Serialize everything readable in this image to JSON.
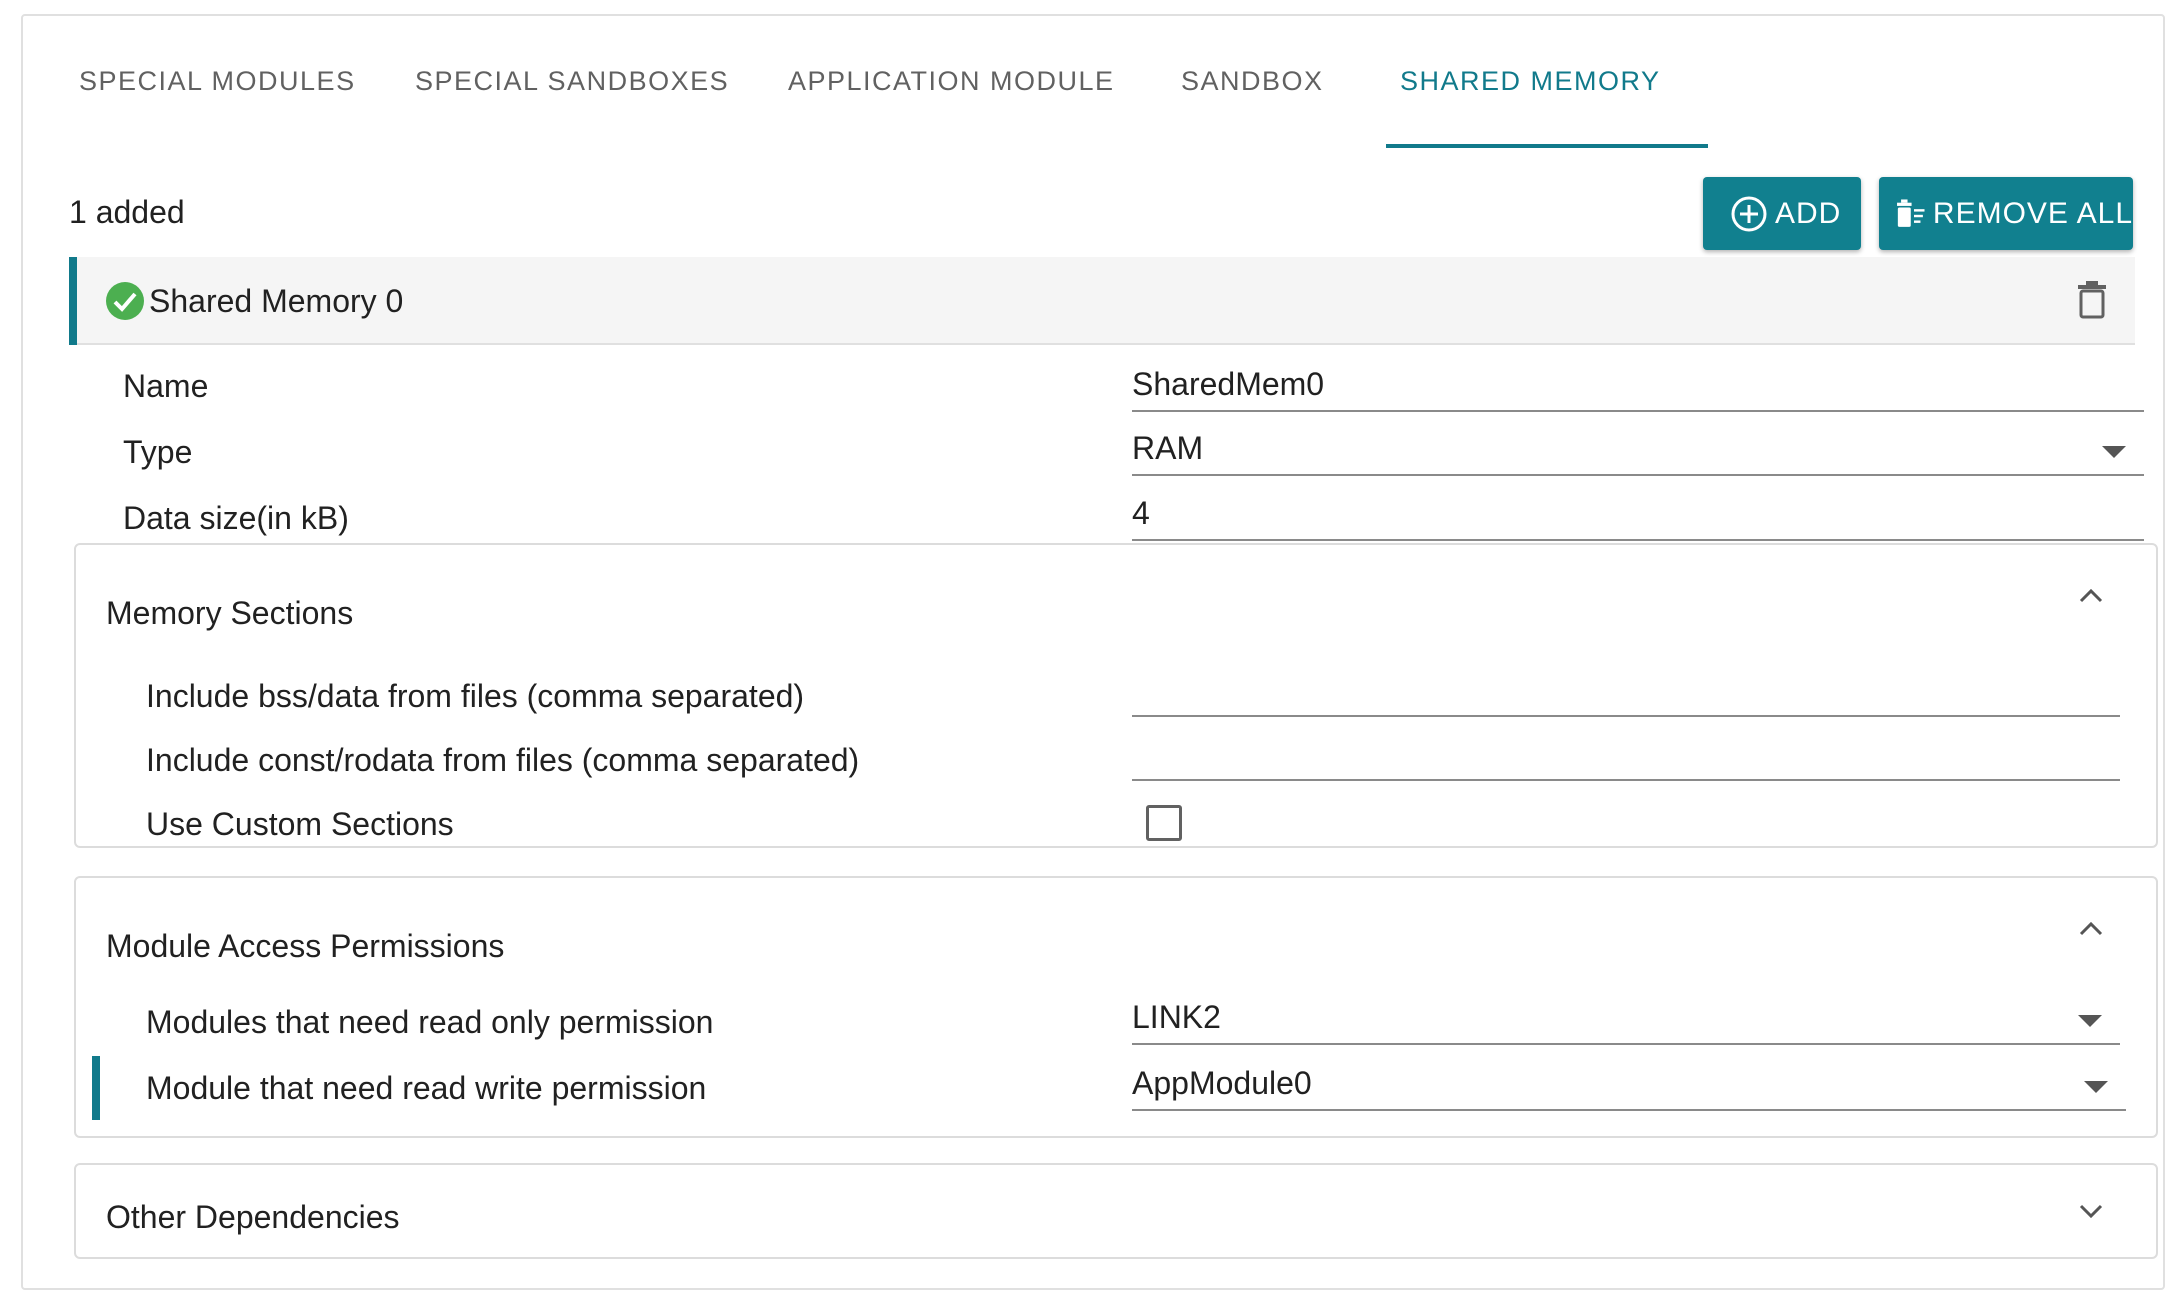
{
  "tabs": [
    {
      "label": "SPECIAL MODULES"
    },
    {
      "label": "SPECIAL SANDBOXES"
    },
    {
      "label": "APPLICATION MODULE"
    },
    {
      "label": "SANDBOX"
    },
    {
      "label": "SHARED MEMORY",
      "active": true
    }
  ],
  "toolbar": {
    "count_text": "1 added",
    "add_label": "ADD",
    "remove_all_label": "REMOVE ALL"
  },
  "item": {
    "title": "Shared Memory 0",
    "status_icon": "check-circle-icon",
    "fields": {
      "name": {
        "label": "Name",
        "value": "SharedMem0"
      },
      "type": {
        "label": "Type",
        "value": "RAM"
      },
      "data_size": {
        "label": "Data size(in kB)",
        "value": "4"
      }
    }
  },
  "memory_sections": {
    "title": "Memory Sections",
    "bss_label": "Include bss/data from files (comma separated)",
    "bss_value": "",
    "const_label": "Include const/rodata from files (comma separated)",
    "const_value": "",
    "custom_label": "Use Custom Sections",
    "custom_checked": false
  },
  "module_access": {
    "title": "Module Access Permissions",
    "read_only_label": "Modules that need read only permission",
    "read_only_value": "LINK2",
    "read_write_label": "Module that need read write permission",
    "read_write_value": "AppModule0"
  },
  "other_dependencies": {
    "title": "Other Dependencies"
  },
  "colors": {
    "accent": "#117a8b",
    "button": "#11808f",
    "success": "#4caf50"
  }
}
